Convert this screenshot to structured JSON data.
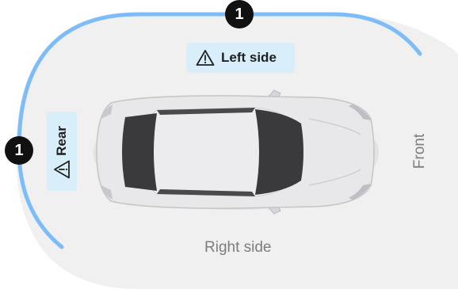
{
  "zones": {
    "left": {
      "label": "Left side",
      "warning_icon": "warning-triangle-icon",
      "badge": "1"
    },
    "rear": {
      "label": "Rear",
      "warning_icon": "warning-triangle-icon",
      "badge": "1"
    },
    "right": {
      "label": "Right side"
    },
    "front": {
      "label": "Front"
    }
  },
  "colors": {
    "panel_bg": "#f0f0f0",
    "arc_highlight": "#7dbcf7",
    "chip_bg": "#d9eefb",
    "badge_bg": "#111111",
    "car_body": "#e8e8ea",
    "car_glass": "#3a3a3d"
  }
}
